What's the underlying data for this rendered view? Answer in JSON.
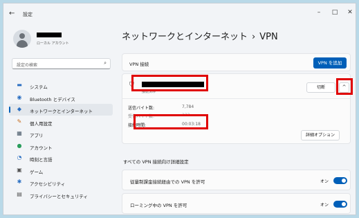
{
  "window": {
    "back_icon": "←",
    "title": "設定",
    "controls": [
      "–",
      "□",
      "✕"
    ]
  },
  "user": {
    "name": "",
    "account_type": "ローカル アカウント"
  },
  "search": {
    "placeholder": "設定の検索",
    "icon": "search-icon"
  },
  "nav": {
    "items": [
      {
        "label": "システム",
        "icon": "▬"
      },
      {
        "label": "Bluetooth とデバイス",
        "icon": "◉"
      },
      {
        "label": "ネットワークとインターネット",
        "icon": "◆"
      },
      {
        "label": "個人用設定",
        "icon": "✎"
      },
      {
        "label": "アプリ",
        "icon": "▦"
      },
      {
        "label": "アカウント",
        "icon": "●"
      },
      {
        "label": "時刻と言語",
        "icon": "◔"
      },
      {
        "label": "ゲーム",
        "icon": "▣"
      },
      {
        "label": "アクセシビリティ",
        "icon": "✱"
      },
      {
        "label": "プライバシーとセキュリティ",
        "icon": "▤"
      }
    ],
    "active_index": 2
  },
  "breadcrumb": {
    "parent": "ネットワークとインターネット",
    "separator": "›",
    "current": "VPN"
  },
  "vpn_connections": {
    "label": "VPN 接続",
    "add_button": "VPN を追加"
  },
  "vpn_entry": {
    "name": "",
    "status": "接続済み",
    "disconnect_button": "切断",
    "expand_icon": "^",
    "stats": [
      {
        "label": "送信バイト数:",
        "value": "7,784"
      },
      {
        "label": "受信バイト数:",
        "value": "233"
      },
      {
        "label": "接続時間:",
        "value": "00:03:18"
      }
    ],
    "advanced_button": "詳細オプション"
  },
  "advanced_settings": {
    "heading": "すべての VPN 接続向け詳細設定",
    "toggles": [
      {
        "label": "従量制課金接続経由での VPN を許可",
        "state": "オン"
      },
      {
        "label": "ローミング中の VPN を許可",
        "state": "オン"
      }
    ]
  },
  "colors": {
    "accent": "#005fb8",
    "highlight": "#e00000"
  }
}
